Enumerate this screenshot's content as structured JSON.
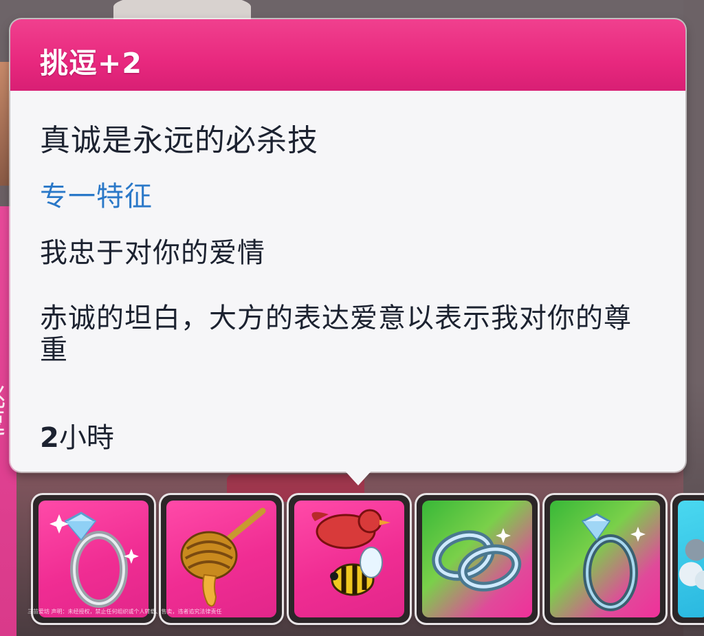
{
  "tooltip": {
    "header": "挑逗+2",
    "title": "真诚是永远的必杀技",
    "trait": "专一特征",
    "line1": "我忠于对你的爱情",
    "description": "赤诚的坦白，大方的表达爱意以表示我对你的尊重",
    "duration_value": "2",
    "duration_unit": "小時"
  },
  "background": {
    "left_vertical_text": "挑逗"
  },
  "interactions": [
    {
      "icon": "diamond-ring-icon",
      "color": "pink"
    },
    {
      "icon": "honey-dipper-icon",
      "color": "pink"
    },
    {
      "icon": "birds-and-bees-icon",
      "color": "pink"
    },
    {
      "icon": "wedding-rings-icon",
      "color": "green-pink"
    },
    {
      "icon": "engagement-ring-icon",
      "color": "green-pink"
    },
    {
      "icon": "cloud-icon",
      "color": "cyan"
    }
  ],
  "watermark": "三苗爱坊 声明：未经授权，禁止任何组织或个人转载、售卖，违者追究法律责任",
  "colors": {
    "header_pink": "#e8287e",
    "trait_blue": "#2a78c8",
    "text_dark": "#1c2230"
  }
}
